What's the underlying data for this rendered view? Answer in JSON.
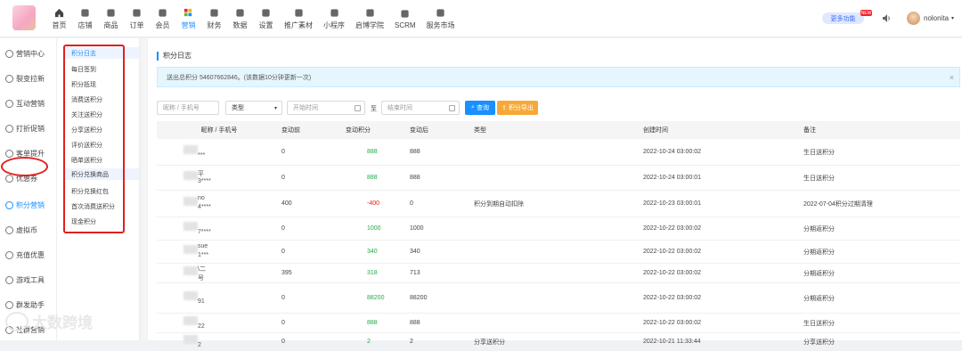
{
  "nav": [
    {
      "label": "首页",
      "icon": "home-icon"
    },
    {
      "label": "店铺",
      "icon": "store-icon"
    },
    {
      "label": "商品",
      "icon": "goods-icon"
    },
    {
      "label": "订单",
      "icon": "order-icon"
    },
    {
      "label": "会员",
      "icon": "member-icon"
    },
    {
      "label": "营销",
      "icon": "marketing-icon"
    },
    {
      "label": "财务",
      "icon": "finance-icon"
    },
    {
      "label": "数据",
      "icon": "data-icon"
    },
    {
      "label": "设置",
      "icon": "settings-icon"
    },
    {
      "label": "推广素材",
      "icon": "share-icon"
    },
    {
      "label": "小程序",
      "icon": "miniprogram-icon"
    },
    {
      "label": "启博学院",
      "icon": "academy-icon"
    },
    {
      "label": "SCRM",
      "icon": "scrm-icon"
    },
    {
      "label": "服务市场",
      "icon": "service-icon"
    }
  ],
  "active_nav": "营销",
  "header": {
    "more_label": "更多功能",
    "new_badge": "NEW",
    "username": "nolonita"
  },
  "sidebar": [
    {
      "label": "营销中心"
    },
    {
      "label": "裂变拉新"
    },
    {
      "label": "互动营销"
    },
    {
      "label": "打折促销"
    },
    {
      "label": "客单提升"
    },
    {
      "label": "优惠券"
    },
    {
      "label": "积分营销"
    },
    {
      "label": "虚拟币"
    },
    {
      "label": "充值优惠"
    },
    {
      "label": "游戏工具"
    },
    {
      "label": "群发助手"
    },
    {
      "label": "社群营销"
    }
  ],
  "subsidebar": [
    {
      "label": "积分日志"
    },
    {
      "label": "每日签到"
    },
    {
      "label": "积分抵现"
    },
    {
      "label": "消费送积分"
    },
    {
      "label": "关注送积分"
    },
    {
      "label": "分享送积分"
    },
    {
      "label": "评价送积分"
    },
    {
      "label": "晒单送积分"
    },
    {
      "label": "积分兑换商品"
    },
    {
      "label": "积分兑换红包"
    },
    {
      "label": "首次消费送积分"
    },
    {
      "label": "现金积分"
    }
  ],
  "page": {
    "title": "积分日志",
    "notice": "送出总积分 54607662846。(该数据10分钟更新一次)",
    "notice_close": "×"
  },
  "filters": {
    "nickname_placeholder": "昵称 / 手机号",
    "type_value": "类型",
    "start_placeholder": "开始时间",
    "to_label": "至",
    "end_placeholder": "结束时间",
    "query_label": "查询",
    "export_label": "积分导出"
  },
  "table": {
    "headers": [
      "昵称 / 手机号",
      "变动前",
      "变动积分",
      "变动后",
      "类型",
      "创建时间",
      "备注"
    ],
    "rows": [
      {
        "nick_a": "",
        "nick_b": "***",
        "before": "0",
        "change": "888",
        "after": "888",
        "type": "",
        "time": "2022-10-24 03:00:02",
        "note": "生日送积分"
      },
      {
        "nick_a": "平",
        "nick_b": "3****",
        "before": "0",
        "change": "888",
        "after": "888",
        "type": "",
        "time": "2022-10-24 03:00:01",
        "note": "生日送积分"
      },
      {
        "nick_a": "no",
        "nick_b": "4****",
        "before": "400",
        "change": "-400",
        "after": "0",
        "type": "积分到期自动扣除",
        "time": "2022-10-23 03:00:01",
        "note": "2022-07-04积分过期清理"
      },
      {
        "nick_a": "",
        "nick_b": "7****",
        "before": "0",
        "change": "1000",
        "after": "1000",
        "type": "",
        "time": "2022-10-22 03:00:02",
        "note": "分期返积分"
      },
      {
        "nick_a": "sue",
        "nick_b": "1***",
        "before": "0",
        "change": "340",
        "after": "340",
        "type": "",
        "time": "2022-10-22 03:00:02",
        "note": "分期返积分"
      },
      {
        "nick_a": "\\二",
        "nick_b": "号",
        "before": "395",
        "change": "318",
        "after": "713",
        "type": "",
        "time": "2022-10-22 03:00:02",
        "note": "分期返积分"
      },
      {
        "nick_a": "",
        "nick_b": "91",
        "before": "0",
        "change": "88200",
        "after": "88200",
        "type": "",
        "time": "2022-10-22 03:00:02",
        "note": "分期返积分"
      },
      {
        "nick_a": "",
        "nick_b": "22",
        "before": "0",
        "change": "888",
        "after": "888",
        "type": "",
        "time": "2022-10-22 03:00:02",
        "note": "生日送积分"
      },
      {
        "nick_a": "",
        "nick_b": "2",
        "before": "0",
        "change": "2",
        "after": "2",
        "type": "分享送积分",
        "time": "2022-10-21 11:33:44",
        "note": "分享送积分"
      }
    ]
  },
  "watermark": "大数跨境"
}
